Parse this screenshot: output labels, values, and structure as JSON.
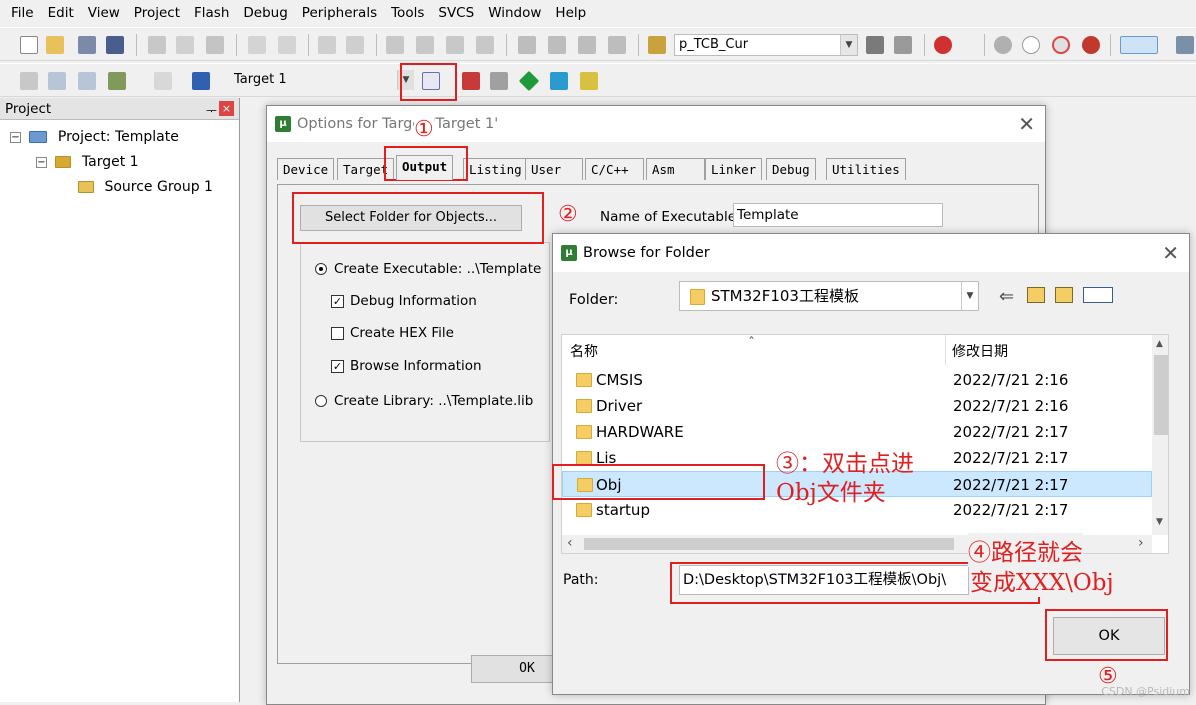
{
  "menu": [
    "File",
    "Edit",
    "View",
    "Project",
    "Flash",
    "Debug",
    "Peripherals",
    "Tools",
    "SVCS",
    "Window",
    "Help"
  ],
  "toolbar1": {
    "find_combo": "p_TCB_Cur"
  },
  "toolbar2": {
    "target_combo": "Target 1"
  },
  "project_pane": {
    "title": "Project",
    "pin": "❓",
    "close": "×",
    "project": "Project: Template",
    "target": "Target 1",
    "group": "Source Group 1",
    "expand1": "−",
    "expand2": "−"
  },
  "options": {
    "title": "Options for Target 'Target 1'",
    "close": "✕",
    "tabs": [
      "Device",
      "Target",
      "Output",
      "Listing",
      "User",
      "C/C++",
      "Asm",
      "Linker",
      "Debug",
      "Utilities"
    ],
    "select_folder": "Select Folder for Objects...",
    "name_label": "Name of Executable:",
    "name_value": "Template",
    "create_exe": "Create Executable:  ..\\Template",
    "debug_info": "Debug Information",
    "hex": "Create HEX File",
    "browse_info": "Browse Information",
    "library": "Create Library:  ..\\Template.lib",
    "ok": "OK",
    "check": "✓"
  },
  "browse": {
    "title": "Browse for Folder",
    "close": "✕",
    "folder_label": "Folder:",
    "folder_value": "STM32F103工程模板",
    "col_name": "名称",
    "col_date": "修改日期",
    "sort_arrow": "ˆ",
    "rows": [
      {
        "name": "CMSIS",
        "date": "2022/7/21 2:16"
      },
      {
        "name": "Driver",
        "date": "2022/7/21 2:16"
      },
      {
        "name": "HARDWARE",
        "date": "2022/7/21 2:17"
      },
      {
        "name": "Lis",
        "date": "2022/7/21 2:17"
      },
      {
        "name": "Obj",
        "date": "2022/7/21 2:17"
      },
      {
        "name": "startup",
        "date": "2022/7/21 2:17"
      }
    ],
    "path_label": "Path:",
    "path_value": "D:\\Desktop\\STM32F103工程模板\\Obj\\",
    "ok": "OK",
    "up": "▲",
    "down": "▼",
    "left": "‹",
    "right": "›"
  },
  "annotations": {
    "a1": "①",
    "a2": "②",
    "a3a": "③：双击点进",
    "a3b": "Obj文件夹",
    "a4a": "④路径就会",
    "a4b": "变成XXX\\Obj",
    "a5": "⑤"
  },
  "watermark": "CSDN @Psidium",
  "colors": {
    "annotation": "#e02020",
    "selection": "#cce8ff"
  }
}
